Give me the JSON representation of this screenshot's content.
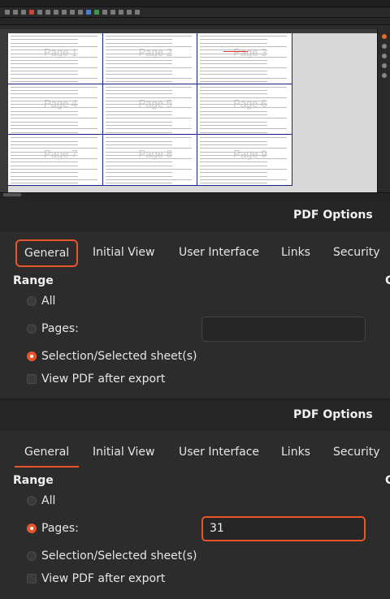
{
  "spreadsheet": {
    "pages": [
      {
        "label": "Page 1"
      },
      {
        "label": "Page 2"
      },
      {
        "label": "Page 3"
      },
      {
        "label": "Page 4"
      },
      {
        "label": "Page 5"
      },
      {
        "label": "Page 6"
      },
      {
        "label": "Page 7"
      },
      {
        "label": "Page 8"
      },
      {
        "label": "Page 9"
      }
    ]
  },
  "dialog_before": {
    "title": "PDF Options",
    "tabs": [
      "General",
      "Initial View",
      "User Interface",
      "Links",
      "Security"
    ],
    "active_tab": "General",
    "range_heading": "Range",
    "options": {
      "all": "All",
      "pages": "Pages:",
      "selection": "Selection/Selected sheet(s)",
      "view_after": "View PDF after export"
    },
    "pages_value": "",
    "selected": "selection",
    "right_cut_heading": "C"
  },
  "dialog_after": {
    "title": "PDF Options",
    "tabs": [
      "General",
      "Initial View",
      "User Interface",
      "Links",
      "Security"
    ],
    "active_tab": "General",
    "range_heading": "Range",
    "options": {
      "all": "All",
      "pages": "Pages:",
      "selection": "Selection/Selected sheet(s)",
      "view_after": "View PDF after export"
    },
    "pages_value": "31",
    "selected": "pages",
    "right_cut_heading": "C"
  },
  "colors": {
    "accent": "#e8552a",
    "dialog_bg": "#2c2c2c",
    "page_border": "#1b1f8a"
  }
}
